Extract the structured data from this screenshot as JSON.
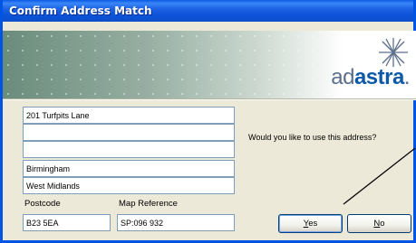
{
  "window": {
    "title": "Confirm Address Match"
  },
  "banner": {
    "logo_prefix": "ad",
    "logo_accent": "astra",
    "logo_suffix": "."
  },
  "address": {
    "line1": "201 Turfpits Lane",
    "line2": "",
    "line3": "",
    "town": "Birmingham",
    "county": "West Midlands",
    "postcode_label": "Postcode",
    "postcode": "B23 5EA",
    "mapref_label": "Map Reference",
    "mapref": "SP:096 932"
  },
  "prompt": {
    "question": "Would you like to use this address?"
  },
  "buttons": {
    "yes_hotkey": "Y",
    "yes_rest": "es",
    "no_hotkey": "N",
    "no_rest": "o"
  },
  "colors": {
    "titlebar": "#0b53d9",
    "window_bg": "#ece9d8",
    "logo_accent": "#0f5aa8"
  }
}
